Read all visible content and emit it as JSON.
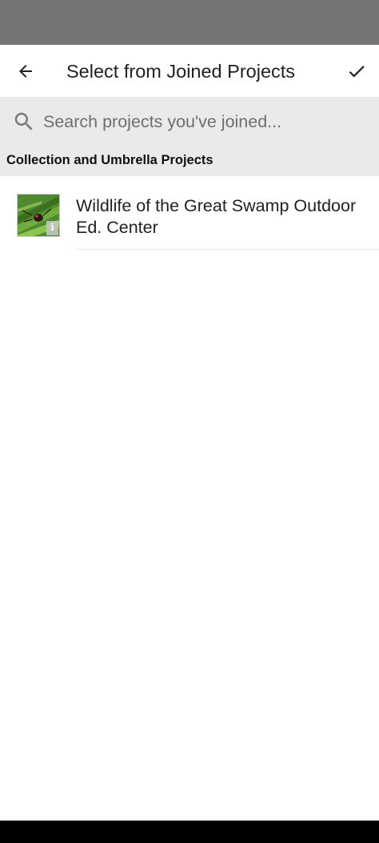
{
  "app_bar": {
    "title": "Select from Joined Projects",
    "back_icon": "arrow-left-icon",
    "confirm_icon": "checkmark-icon"
  },
  "search": {
    "placeholder": "Search projects you've joined...",
    "value": "",
    "icon": "search-icon"
  },
  "section": {
    "title": "Collection and Umbrella Projects"
  },
  "projects": [
    {
      "name": "Wildlife of the Great Swamp Outdoor Ed. Center",
      "thumbnail": "insect-on-leaf-photo",
      "badge": "i"
    }
  ],
  "colors": {
    "status_bar": "#757575",
    "search_background": "#eaeaea",
    "text_primary": "#212121",
    "navigation_bar": "#000000"
  }
}
